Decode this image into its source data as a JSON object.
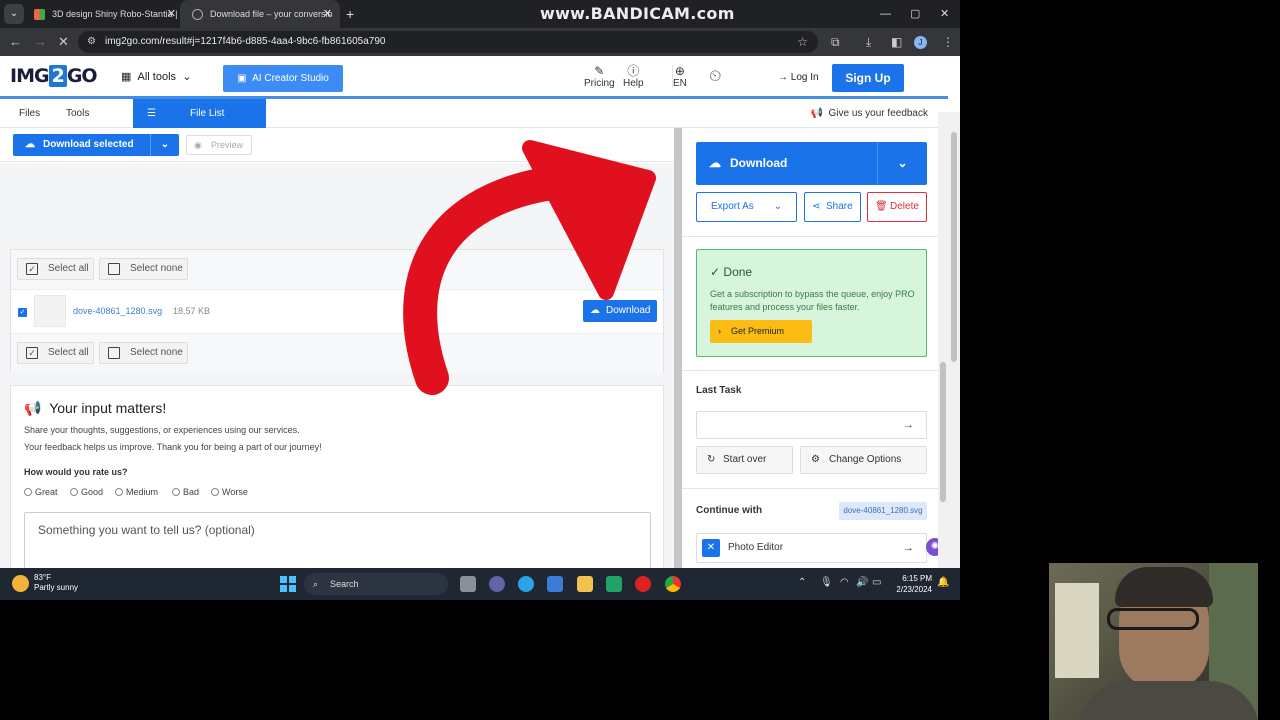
{
  "browser": {
    "tabs": [
      {
        "title": "3D design Shiny Robo-Stantia |",
        "active": false
      },
      {
        "title": "Download file – your conversio",
        "active": true
      }
    ],
    "url": "img2go.com/result#j=1217f4b6-d885-4aa4-9bc6-fb861605a790",
    "watermark": "www.BANDICAM.com"
  },
  "header": {
    "logo_left": "IMG",
    "logo_mid": "2",
    "logo_right": "GO",
    "all_tools": "All tools",
    "ai_creator": "AI Creator Studio",
    "pricing": "Pricing",
    "help": "Help",
    "lang": "EN",
    "login": "Log In",
    "signup": "Sign Up"
  },
  "subbar": {
    "files": "Files",
    "tools": "Tools",
    "file_list": "File List",
    "feedback": "Give us your feedback"
  },
  "left": {
    "download_selected": "Download selected",
    "preview": "Preview",
    "select_all": "Select all",
    "select_none": "Select none",
    "file": {
      "name": "dove-40861_1280.svg",
      "size": "18.57 KB",
      "download": "Download"
    },
    "input_title": "Your input matters!",
    "input_line1": "Share your thoughts, suggestions, or experiences using our services.",
    "input_line2": "Your feedback helps us improve. Thank you for being a part of our journey!",
    "rate_question": "How would you rate us?",
    "ratings": [
      "Great",
      "Good",
      "Medium",
      "Bad",
      "Worse"
    ],
    "textarea_placeholder": "Something you want to tell us? (optional)"
  },
  "right": {
    "download": "Download",
    "export_as": "Export As",
    "share": "Share",
    "delete": "Delete",
    "done_title": "Done",
    "done_text": "Get a subscription to bypass the queue, enjoy PRO features and process your files faster.",
    "get_premium": "Get Premium",
    "last_task": "Last Task",
    "start_over": "Start over",
    "change_options": "Change Options",
    "continue_with": "Continue with",
    "continue_file": "dove-40861_1280.svg",
    "photo_editor": "Photo Editor"
  },
  "taskbar": {
    "temp": "83°F",
    "weather": "Partly sunny",
    "search": "Search",
    "time": "6:15 PM",
    "date": "2/23/2024"
  },
  "colors": {
    "accent": "#1a73e8",
    "done_bg": "#d7f5dd",
    "premium": "#fbbd14",
    "delete": "#d9323a",
    "arrow": "#e0101e"
  }
}
